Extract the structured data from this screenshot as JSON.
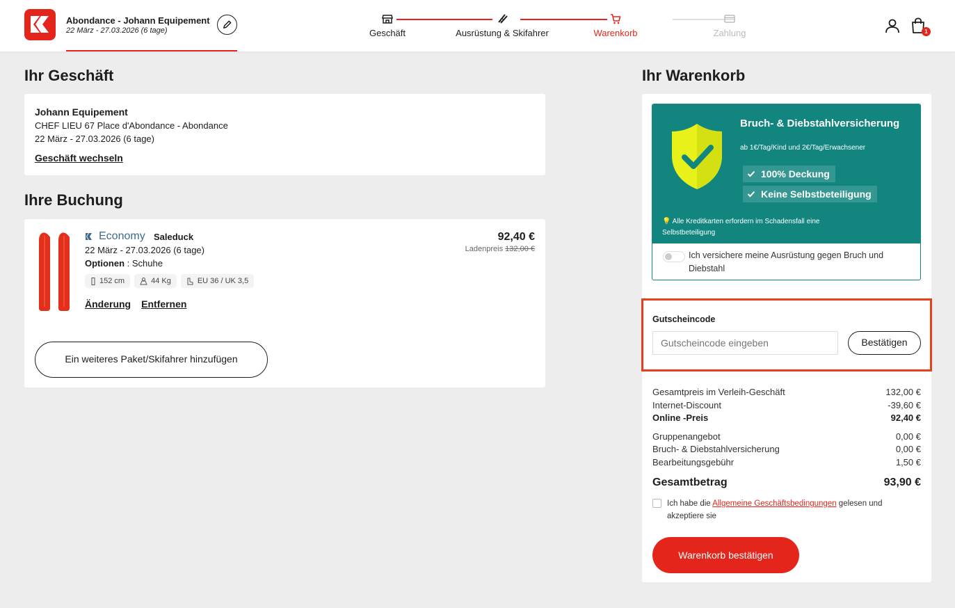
{
  "header": {
    "store_title": "Abondance - Johann Equipement",
    "store_dates": "22 März - 27.03.2026 (6 tage)",
    "steps": [
      {
        "label": "Geschäft",
        "state": "done"
      },
      {
        "label": "Ausrüstung & Skifahrer",
        "state": "done"
      },
      {
        "label": "Warenkorb",
        "state": "active"
      },
      {
        "label": "Zahlung",
        "state": "pending"
      }
    ],
    "cart_count": "1"
  },
  "store_section": {
    "heading": "Ihr Geschäft",
    "name": "Johann Equipement",
    "address": "CHEF LIEU 67 Place d'Abondance - Abondance",
    "dates": "22 März - 27.03.2026 (6 tage)",
    "change_link": "Geschäft wechseln"
  },
  "booking_section": {
    "heading": "Ihre Buchung",
    "brand": "Economy",
    "model": "Saleduck",
    "dates": "22 März - 27.03.2026 (6 tage)",
    "options_label": "Optionen",
    "options_value": " : Schuhe",
    "chips": [
      "152 cm",
      "44 Kg",
      "EU 36 / UK 3,5"
    ],
    "edit_link": "Änderung",
    "remove_link": "Entfernen",
    "price": "92,40 €",
    "store_price_label": "Ladenpreis",
    "store_price_value": "132,00 €",
    "add_button": "Ein weiteres Paket/Skifahrer hinzufügen"
  },
  "cart_section": {
    "heading": "Ihr Warenkorb",
    "insurance": {
      "title": "Bruch- & Diebstahlversicherung",
      "subtitle": "ab 1€/Tag/Kind und 2€/Tag/Erwachsener",
      "benefits": [
        "100% Deckung",
        "Keine Selbstbeteiligung"
      ],
      "note": "💡 Alle Kreditkarten erfordern im Schadensfall eine Selbstbeteiligung",
      "toggle_label": "Ich versichere meine Ausrüstung gegen Bruch und Diebstahl",
      "toggle_on": false,
      "colors": {
        "panel": "#11857e",
        "shield": "#e8f21a"
      }
    },
    "voucher": {
      "label": "Gutscheincode",
      "placeholder": "Gutscheincode eingeben",
      "button": "Bestätigen"
    },
    "totals": [
      {
        "label": "Gesamtpreis im Verleih-Geschäft",
        "value": "132,00 €",
        "style": "normal"
      },
      {
        "label": "Internet-Discount",
        "value": "-39,60 €",
        "style": "normal"
      },
      {
        "label": "Online -Preis",
        "value": "92,40 €",
        "style": "bold"
      },
      {
        "label": "Gruppenangebot",
        "value": "0,00 €",
        "style": "normal"
      },
      {
        "label": "Bruch- & Diebstahlversicherung",
        "value": "0,00 €",
        "style": "normal"
      },
      {
        "label": "Bearbeitungsgebühr",
        "value": "1,50 €",
        "style": "normal"
      }
    ],
    "grand_total_label": "Gesamtbetrag",
    "grand_total_value": "93,90 €",
    "terms_before": "Ich habe die ",
    "terms_link": "Allgemeine Geschäftsbedingungen",
    "terms_after": " gelesen und akzeptiere sie",
    "confirm_button": "Warenkorb bestätigen"
  },
  "colors": {
    "accent": "#e4251b",
    "teal": "#11857e"
  }
}
